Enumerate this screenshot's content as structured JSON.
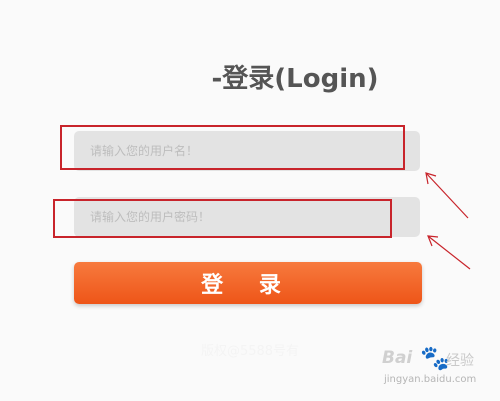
{
  "title": "-登录(Login)",
  "username": {
    "placeholder": "请输入您的用户名！"
  },
  "password": {
    "placeholder": "请输入您的用户密码！"
  },
  "login_button": {
    "label": "登 录"
  },
  "footer": {
    "text": "版权@5588号有"
  },
  "watermark": {
    "brand": "Bai",
    "brand_cn": "经验",
    "site": "jingyan.baidu.com"
  },
  "colors": {
    "accent": "#ee5518",
    "highlight": "#c8242b"
  }
}
